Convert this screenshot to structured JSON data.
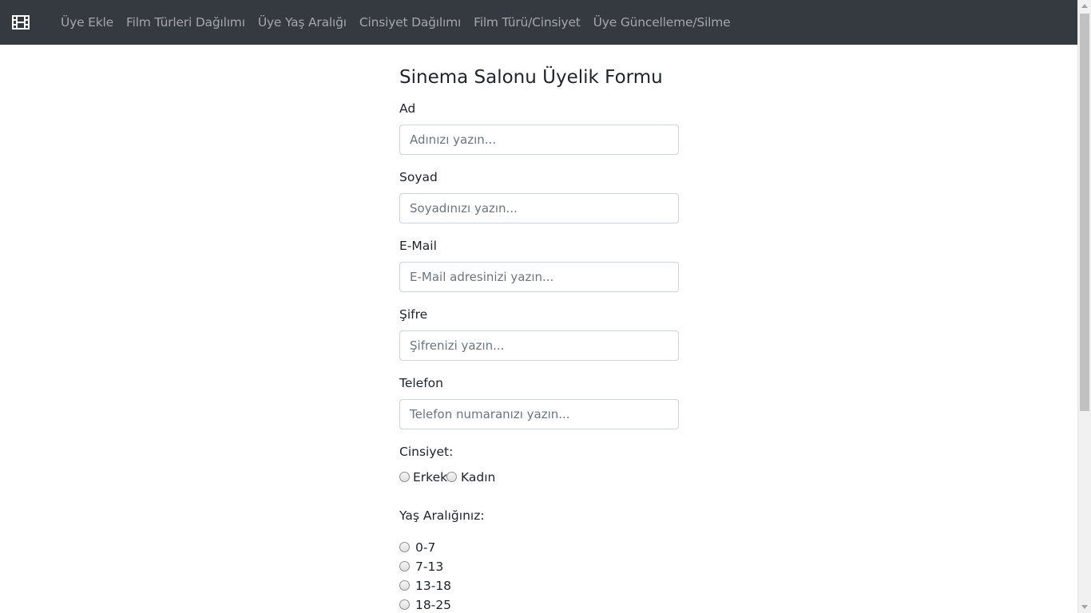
{
  "navbar": {
    "brand_icon": "film-icon",
    "links": [
      "Üye Ekle",
      "Film Türleri Dağılımı",
      "Üye Yaş Aralığı",
      "Cinsiyet Dağılımı",
      "Film Türü/Cinsiyet",
      "Üye Güncelleme/Silme"
    ]
  },
  "form": {
    "title": "Sinema Salonu Üyelik Formu",
    "fields": [
      {
        "label": "Ad",
        "placeholder": "Adınızı yazın...",
        "value": ""
      },
      {
        "label": "Soyad",
        "placeholder": "Soyadınızı yazın...",
        "value": ""
      },
      {
        "label": "E-Mail",
        "placeholder": "E-Mail adresinizi yazın...",
        "value": ""
      },
      {
        "label": "Şifre",
        "placeholder": "Şifrenizi yazın...",
        "value": ""
      },
      {
        "label": "Telefon",
        "placeholder": "Telefon numaranızı yazın...",
        "value": ""
      }
    ],
    "gender": {
      "label": "Cinsiyet:",
      "options": [
        "Erkek",
        "Kadın"
      ]
    },
    "age": {
      "label": "Yaş Aralığınız:",
      "options": [
        "0-7",
        "7-13",
        "13-18",
        "18-25"
      ]
    }
  },
  "colors": {
    "navbar_bg": "#343a40",
    "nav_link": "rgba(255,255,255,0.55)"
  }
}
